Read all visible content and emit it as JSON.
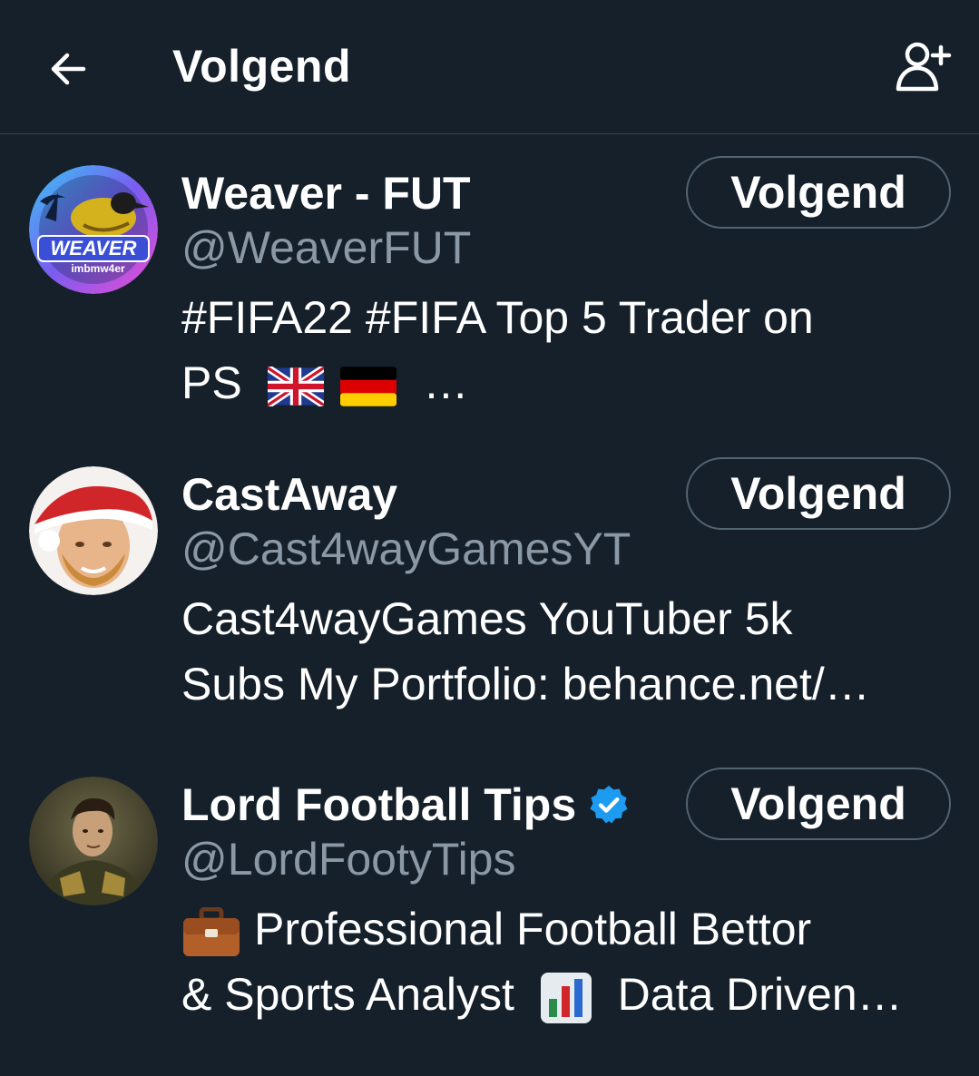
{
  "header": {
    "title": "Volgend"
  },
  "users": [
    {
      "name": "Weaver - FUT",
      "handle": "@WeaverFUT",
      "bio_line1": "#FIFA22 #FIFA  Top 5 Trader on",
      "bio_line2_text": "PS",
      "bio_line2_tail": "…",
      "avatar_text_main": "WEAVER",
      "avatar_text_sub": "imbmw4er",
      "follow_label": "Volgend"
    },
    {
      "name": "CastAway",
      "handle": "@Cast4wayGamesYT",
      "bio_line1": "Cast4wayGames YouTuber 5k",
      "bio_line2": "Subs My Portfolio: behance.net/…",
      "follow_label": "Volgend"
    },
    {
      "name": "Lord Football Tips",
      "handle": "@LordFootyTips",
      "verified": true,
      "bio_line1": "Professional Football Bettor",
      "bio_line2_a": "& Sports Analyst",
      "bio_line2_b": "Data Driven…",
      "follow_label": "Volgend"
    }
  ],
  "icons": {
    "back": "arrow-left-icon",
    "add_user": "add-user-icon",
    "verified": "verified-badge-icon"
  },
  "colors": {
    "background": "#15202b",
    "text": "#ffffff",
    "secondary_text": "#8b98a5",
    "border": "#38444d",
    "verified": "#1d9bf0"
  }
}
